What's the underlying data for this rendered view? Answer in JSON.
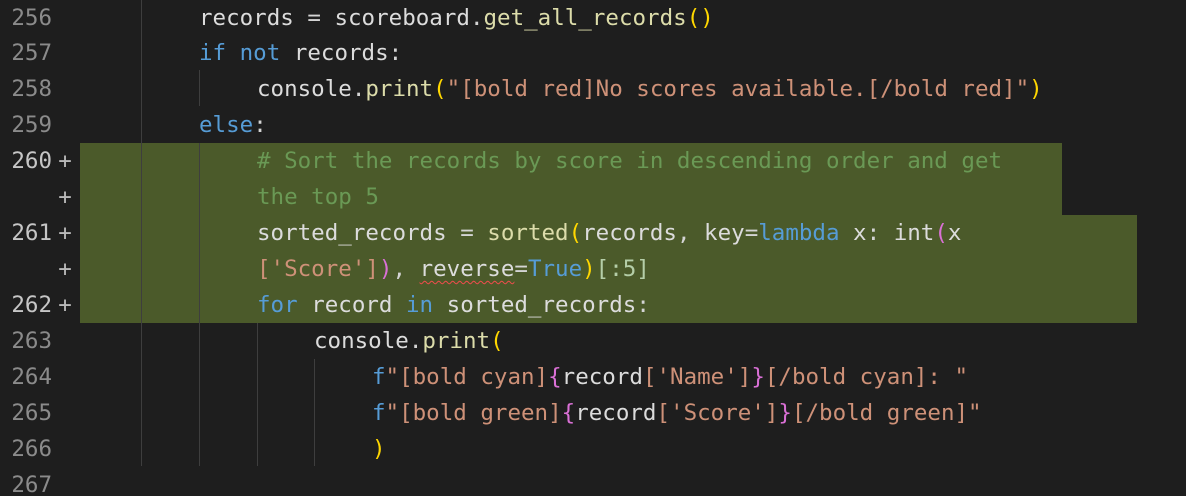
{
  "editor": {
    "line_numbers": [
      "256",
      "257",
      "258",
      "259",
      "260",
      "",
      "261",
      "",
      "262",
      "263",
      "264",
      "265",
      "266",
      "267"
    ],
    "added_marker": "+",
    "code": {
      "l256": {
        "var": "records",
        "eq": " = ",
        "obj": "scoreboard",
        "dot": ".",
        "method": "get_all_records",
        "open": "(",
        "close": ")"
      },
      "l257": {
        "if": "if",
        "not": " not ",
        "var": "records",
        "colon": ":"
      },
      "l258": {
        "obj": "console",
        "dot": ".",
        "method": "print",
        "open": "(",
        "str": "\"[bold red]No scores available.[/bold red]\"",
        "close": ")"
      },
      "l259": {
        "else": "else",
        "colon": ":"
      },
      "l260a": "# Sort the records by score in descending order and get",
      "l260b": "the top 5",
      "l261a": {
        "var": "sorted_records",
        "eq": " = ",
        "fn": "sorted",
        "open": "(",
        "arg": "records",
        "comma": ", ",
        "key": "key",
        "eq2": "=",
        "lambda": "lambda",
        "x": " x",
        "colon": ": ",
        "int": "int",
        "open2": "(",
        "x2": "x"
      },
      "l261b": {
        "str": "['Score']",
        "close2": ")",
        "comma": ", ",
        "reverse": "reverse",
        "eq": "=",
        "true": "True",
        "close": ")",
        "slice": "[:5]"
      },
      "l262": {
        "for": "for",
        "sp1": " ",
        "var": "record",
        "in": " in ",
        "iter": "sorted_records",
        "colon": ":"
      },
      "l263": {
        "obj": "console",
        "dot": ".",
        "method": "print",
        "open": "("
      },
      "l264": {
        "f": "f",
        "s1": "\"[bold cyan]",
        "brace_o": "{",
        "var": "record",
        "idx": "['Name']",
        "brace_c": "}",
        "s2": "[/bold cyan]: \""
      },
      "l265": {
        "f": "f",
        "s1": "\"[bold green]",
        "brace_o": "{",
        "var": "record",
        "idx": "['Score']",
        "brace_c": "}",
        "s2": "[/bold green]\""
      },
      "l266": {
        "close": ")"
      }
    }
  },
  "colors": {
    "background": "#1e1e1e",
    "added_highlight": "#4b5a2a",
    "keyword": "#569cd6",
    "string": "#ce9178",
    "comment": "#6a9955",
    "function": "#dcdcaa"
  }
}
